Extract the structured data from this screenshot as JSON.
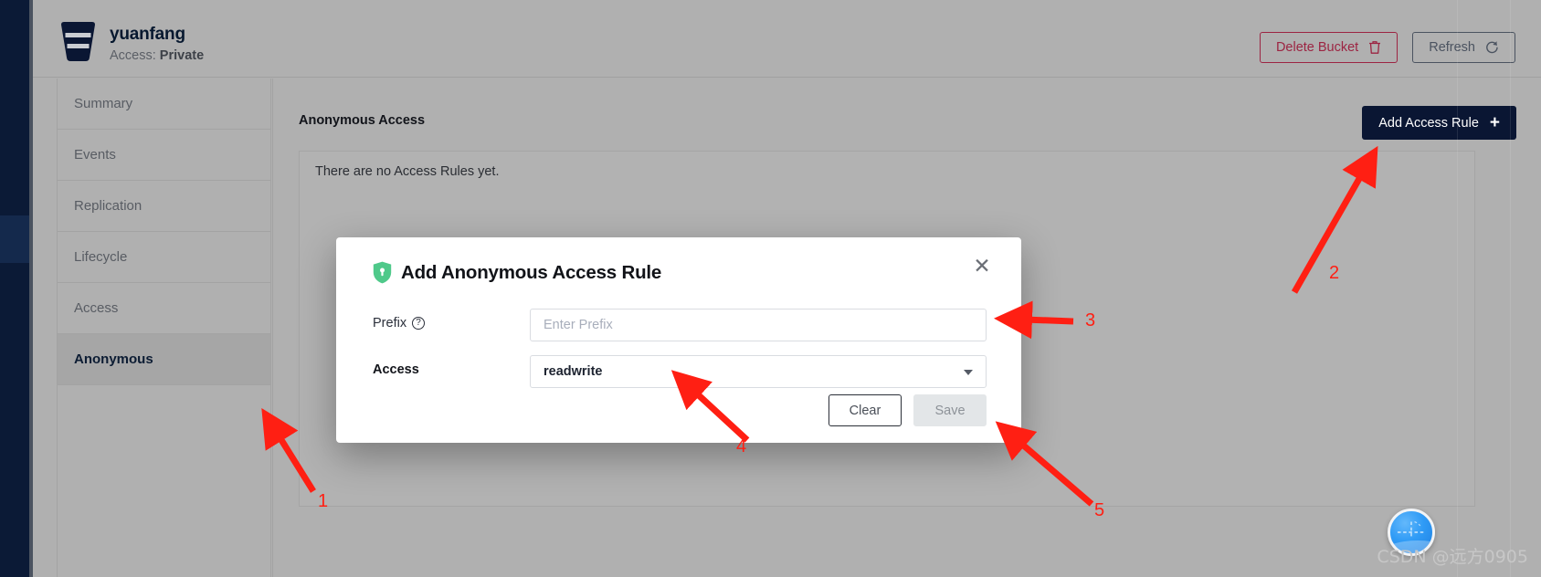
{
  "header": {
    "bucket_name": "yuanfang",
    "access_label": "Access:",
    "access_value": "Private",
    "bucket_icon": "bucket-icon",
    "delete_button": "Delete Bucket",
    "delete_icon": "trash-icon",
    "refresh_button": "Refresh",
    "refresh_icon": "refresh-icon",
    "accent_delete": "#9c2442",
    "accent_dark": "#0a1633"
  },
  "sidebar": {
    "items": [
      {
        "label": "Summary",
        "active": false
      },
      {
        "label": "Events",
        "active": false
      },
      {
        "label": "Replication",
        "active": false
      },
      {
        "label": "Lifecycle",
        "active": false
      },
      {
        "label": "Access",
        "active": false
      },
      {
        "label": "Anonymous",
        "active": true
      }
    ]
  },
  "main": {
    "title": "Anonymous Access",
    "add_rule_button": "Add Access Rule",
    "add_rule_icon": "plus-icon",
    "empty_state": "There are no Access Rules yet."
  },
  "modal": {
    "shield_icon": "shield-lock-icon",
    "title": "Add Anonymous Access Rule",
    "close_icon": "close-icon",
    "prefix": {
      "label": "Prefix",
      "help_icon": "question-mark-icon",
      "help_glyph": "?",
      "value": "",
      "placeholder": "Enter Prefix"
    },
    "access": {
      "label": "Access",
      "selected": "readwrite",
      "caret_icon": "chevron-down-icon"
    },
    "clear_button": "Clear",
    "save_button": "Save"
  },
  "annotations": {
    "numbers": [
      "1",
      "2",
      "3",
      "4",
      "5"
    ],
    "color": "#ff1f13"
  },
  "footer": {
    "globe_icon": "globe-badge-icon",
    "watermark": "CSDN @远方0905"
  }
}
